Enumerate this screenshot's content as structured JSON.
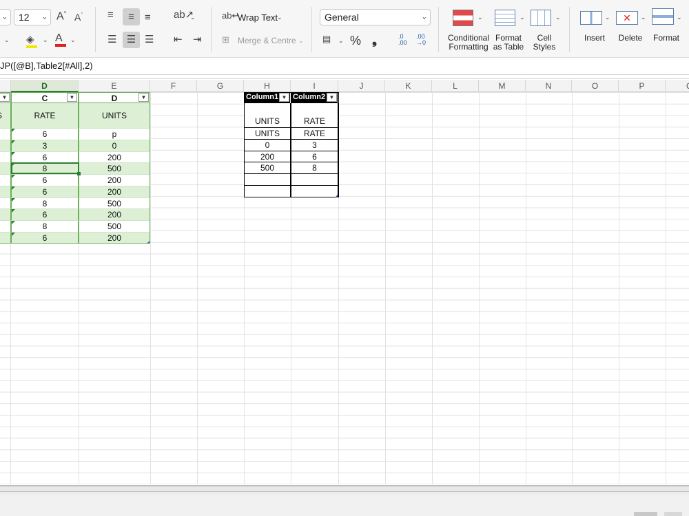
{
  "ribbon": {
    "font_size": "12",
    "number_format": "General",
    "wrap_text": "Wrap Text",
    "merge_centre": "Merge & Centre",
    "percent": "%",
    "comma": "❟",
    "inc_decimal_top": ".0",
    "inc_decimal_bottom": ".00",
    "dec_decimal_top": ".00",
    "dec_decimal_bottom": "→0",
    "conditional_formatting_1": "Conditional",
    "conditional_formatting_2": "Formatting",
    "format_as_table_1": "Format",
    "format_as_table_2": "as Table",
    "cell_styles_1": "Cell",
    "cell_styles_2": "Styles",
    "insert": "Insert",
    "delete": "Delete",
    "format": "Format"
  },
  "formula_bar": {
    "text": "JP([@B],Table2[#All],2)"
  },
  "columns": [
    "D",
    "E",
    "F",
    "G",
    "H",
    "I",
    "J",
    "K",
    "L",
    "M",
    "N",
    "O",
    "P",
    "Q"
  ],
  "table1": {
    "col_headers": [
      "C",
      "D"
    ],
    "header_row": [
      "RATE",
      "UNITS"
    ],
    "left_partial": "S",
    "rows": [
      [
        "6",
        "p"
      ],
      [
        "3",
        "0"
      ],
      [
        "6",
        "200"
      ],
      [
        "8",
        "500"
      ],
      [
        "6",
        "200"
      ],
      [
        "6",
        "200"
      ],
      [
        "8",
        "500"
      ],
      [
        "6",
        "200"
      ],
      [
        "8",
        "500"
      ],
      [
        "6",
        "200"
      ]
    ]
  },
  "table2": {
    "headers": [
      "Column1",
      "Column2"
    ],
    "rows": [
      [
        "UNITS",
        "RATE"
      ],
      [
        "UNITS",
        "RATE"
      ],
      [
        "0",
        "3"
      ],
      [
        "200",
        "6"
      ],
      [
        "500",
        "8"
      ],
      [
        "",
        ""
      ],
      [
        "",
        ""
      ]
    ]
  },
  "colors": {
    "accent_green": "#2d7d32",
    "table_stripe": "#ddf0d6",
    "font_color_red": "#e0201b",
    "highlight_yellow": "#f2e600"
  }
}
